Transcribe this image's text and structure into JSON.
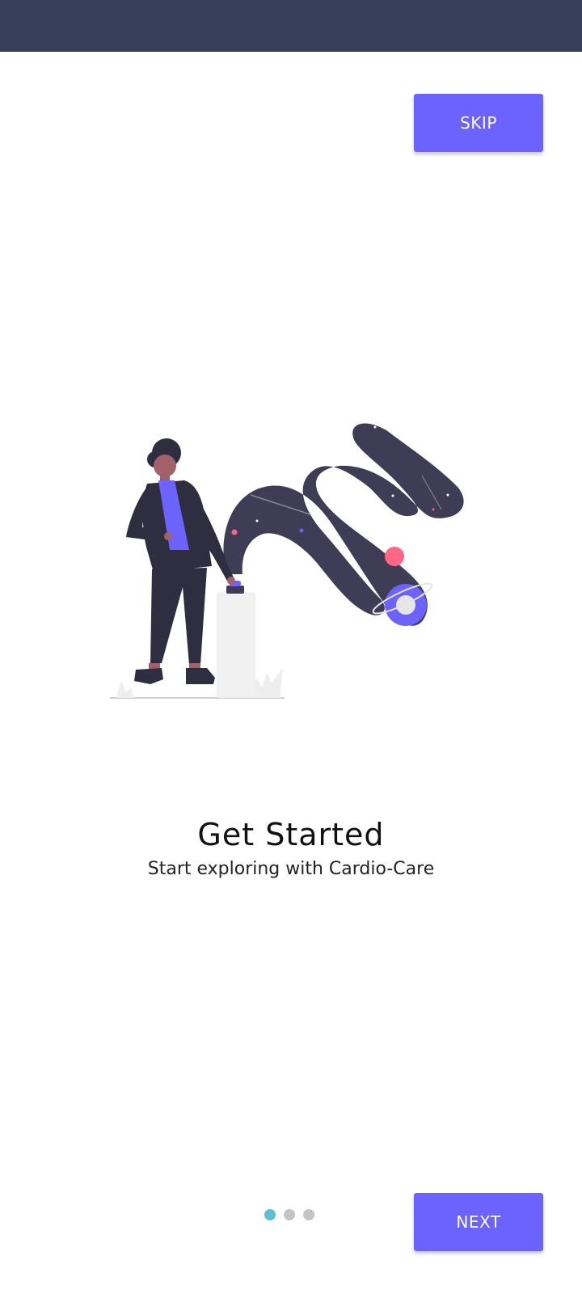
{
  "top_bar": {
    "skip_label": "SKIP"
  },
  "illustration": {
    "icon": "person-launching-space-stream-illustration",
    "accent_color": "#6c63ff"
  },
  "onboarding": {
    "title": "Get Started",
    "subtitle": "Start exploring with Cardio-Care"
  },
  "pager": {
    "page_count": 3,
    "active_index": 0,
    "active_color": "#5bc0d6",
    "inactive_color": "#c4c4c4"
  },
  "bottom_bar": {
    "next_label": "NEXT"
  },
  "colors": {
    "status_bar": "#373f5a",
    "button": "#6c63ff"
  }
}
